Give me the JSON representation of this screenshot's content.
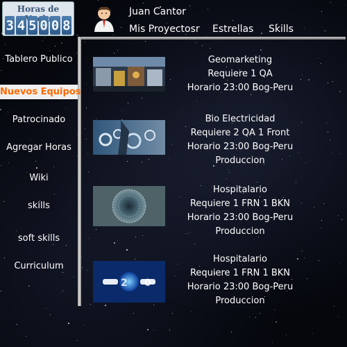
{
  "header": {
    "logo_title": "Horas de Vuelo",
    "logo_digits": [
      "3",
      "4",
      "5",
      "0",
      "0",
      "8"
    ],
    "user_name": "Juan Cantor",
    "avatar_icon": "user-avatar-icon",
    "nav": [
      {
        "label": "Mis Proyectosr"
      },
      {
        "label": "Estrellas"
      },
      {
        "label": "Skills"
      }
    ]
  },
  "sidebar": {
    "items": [
      {
        "label": "Tablero Publico",
        "active": false
      },
      {
        "label": "Nuevos Equipos",
        "active": true
      },
      {
        "label": "Patrocinado",
        "active": false
      },
      {
        "label": "Agregar Horas",
        "active": false
      },
      {
        "label": "Wiki",
        "active": false
      },
      {
        "label": "skills",
        "active": false
      },
      {
        "label": "soft skills",
        "active": false
      },
      {
        "label": "Curriculum",
        "active": false
      }
    ]
  },
  "colors": {
    "active_item": "#ff6a00",
    "background": "#05070d",
    "logo_digit_bg": "#3b6b9c"
  },
  "projects": [
    {
      "image": "industrial-machinery-image",
      "title": "Geomarketing",
      "requirement": "Requiere 1 QA",
      "schedule": "Horario  23:00 Bog-Peru",
      "stage": ""
    },
    {
      "image": "gears-technology-image",
      "title": "Bio Electricidad",
      "requirement": "Requiere 2 QA 1 Front",
      "schedule": "Horario  23:00 Bog-Peru",
      "stage": "Produccion"
    },
    {
      "image": "digital-sphere-image",
      "title": "Hospitalario",
      "requirement": "Requiere 1 FRN 1 BKN",
      "schedule": "Horario  23:00 Bog-Peru",
      "stage": "Produccion"
    },
    {
      "image": "web-2-0-image",
      "title": "Hospitalario",
      "requirement": "Requiere 1 FRN 1 BKN",
      "schedule": "Horario  23:00 Bog-Peru",
      "stage": "Produccion"
    }
  ]
}
